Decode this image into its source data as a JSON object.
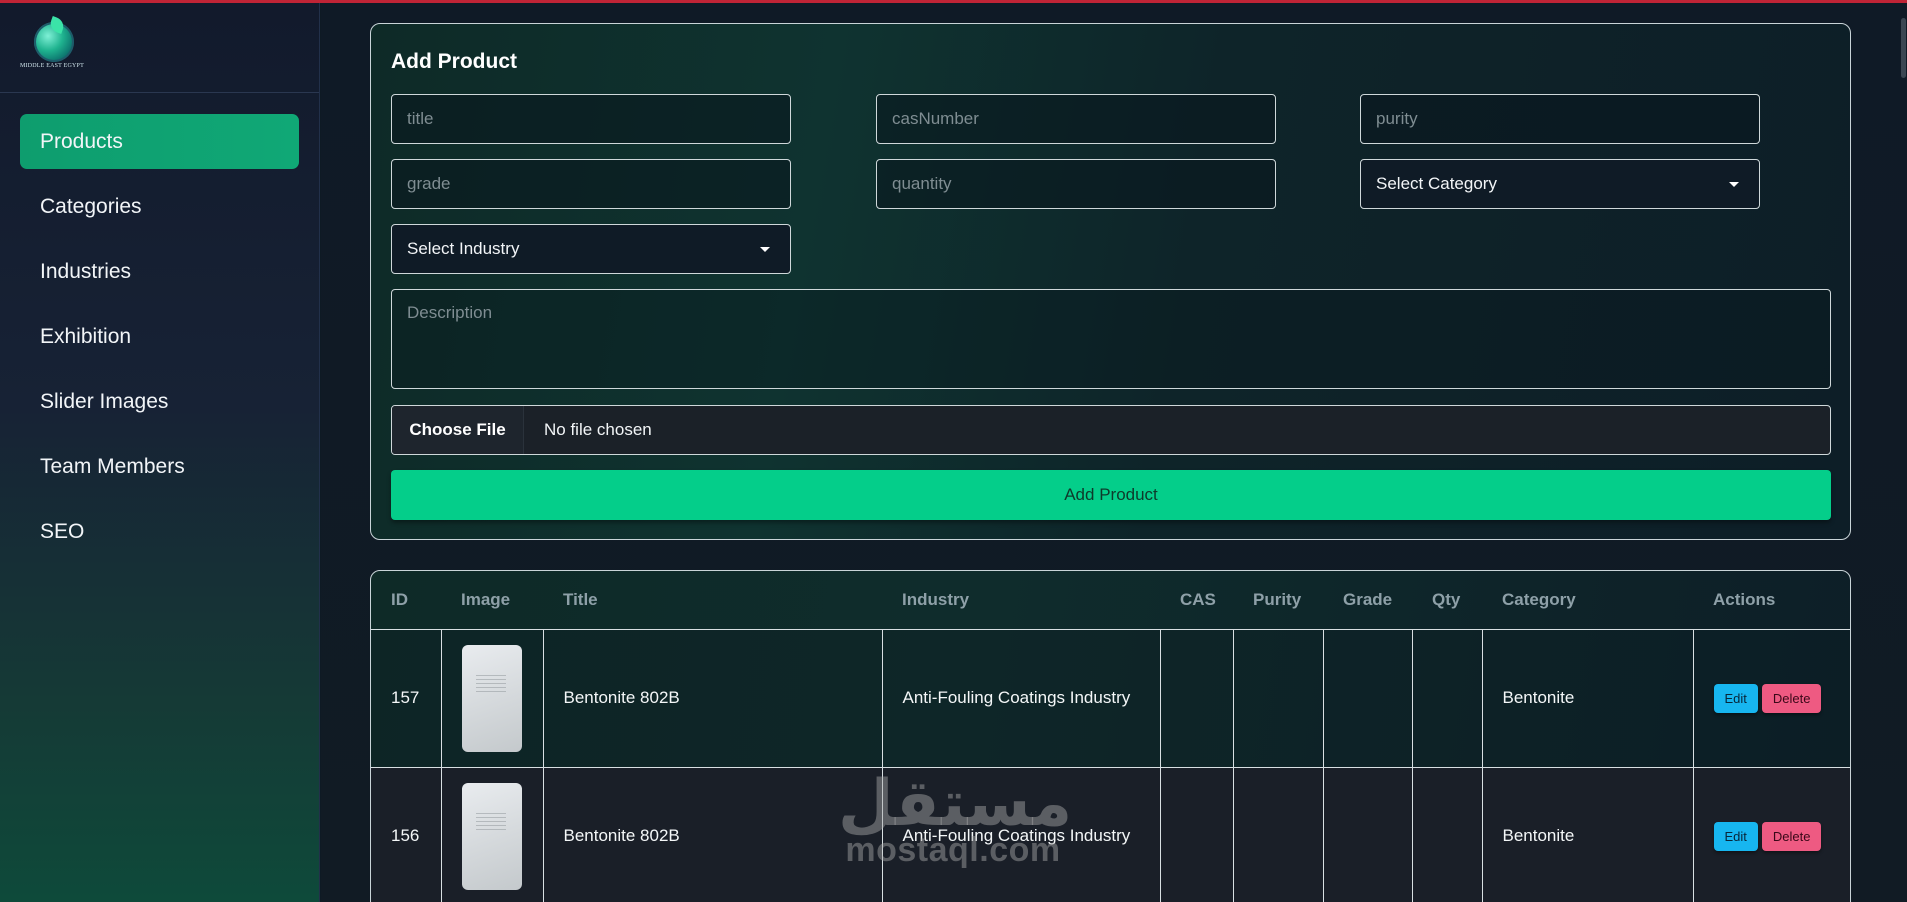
{
  "brand": {
    "logo_alt_text": "MIDDLE EAST EGYPT"
  },
  "sidebar": {
    "items": [
      {
        "label": "Products",
        "active": true
      },
      {
        "label": "Categories",
        "active": false
      },
      {
        "label": "Industries",
        "active": false
      },
      {
        "label": "Exhibition",
        "active": false
      },
      {
        "label": "Slider Images",
        "active": false
      },
      {
        "label": "Team Members",
        "active": false
      },
      {
        "label": "SEO",
        "active": false
      }
    ]
  },
  "form": {
    "title": "Add Product",
    "fields": {
      "title": {
        "placeholder": "title",
        "value": ""
      },
      "cas_number": {
        "placeholder": "casNumber",
        "value": ""
      },
      "purity": {
        "placeholder": "purity",
        "value": ""
      },
      "grade": {
        "placeholder": "grade",
        "value": ""
      },
      "quantity": {
        "placeholder": "quantity",
        "value": ""
      },
      "description": {
        "placeholder": "Description",
        "value": ""
      }
    },
    "category_select": {
      "selected": "Select Category"
    },
    "industry_select": {
      "selected": "Select Industry"
    },
    "file": {
      "button_label": "Choose File",
      "status": "No file chosen"
    },
    "submit_label": "Add Product"
  },
  "table": {
    "headers": [
      "ID",
      "Image",
      "Title",
      "Industry",
      "CAS",
      "Purity",
      "Grade",
      "Qty",
      "Category",
      "Actions"
    ],
    "rows": [
      {
        "id": "157",
        "title": "Bentonite 802B",
        "industry": "Anti-Fouling Coatings Industry",
        "cas": "",
        "purity": "",
        "grade": "",
        "qty": "",
        "category": "Bentonite",
        "edit_label": "Edit",
        "delete_label": "Delete"
      },
      {
        "id": "156",
        "title": "Bentonite 802B",
        "industry": "Anti-Fouling Coatings Industry",
        "cas": "",
        "purity": "",
        "grade": "",
        "qty": "",
        "category": "Bentonite",
        "edit_label": "Edit",
        "delete_label": "Delete"
      }
    ]
  },
  "watermark": {
    "arabic": "مستقل",
    "latin": "mostaql.com"
  },
  "colors": {
    "accent": "#04ce8a",
    "active_nav": "#0e9d6e",
    "edit_button": "#17b6f0",
    "delete_button": "#ee5a82",
    "top_border": "#c02436"
  }
}
